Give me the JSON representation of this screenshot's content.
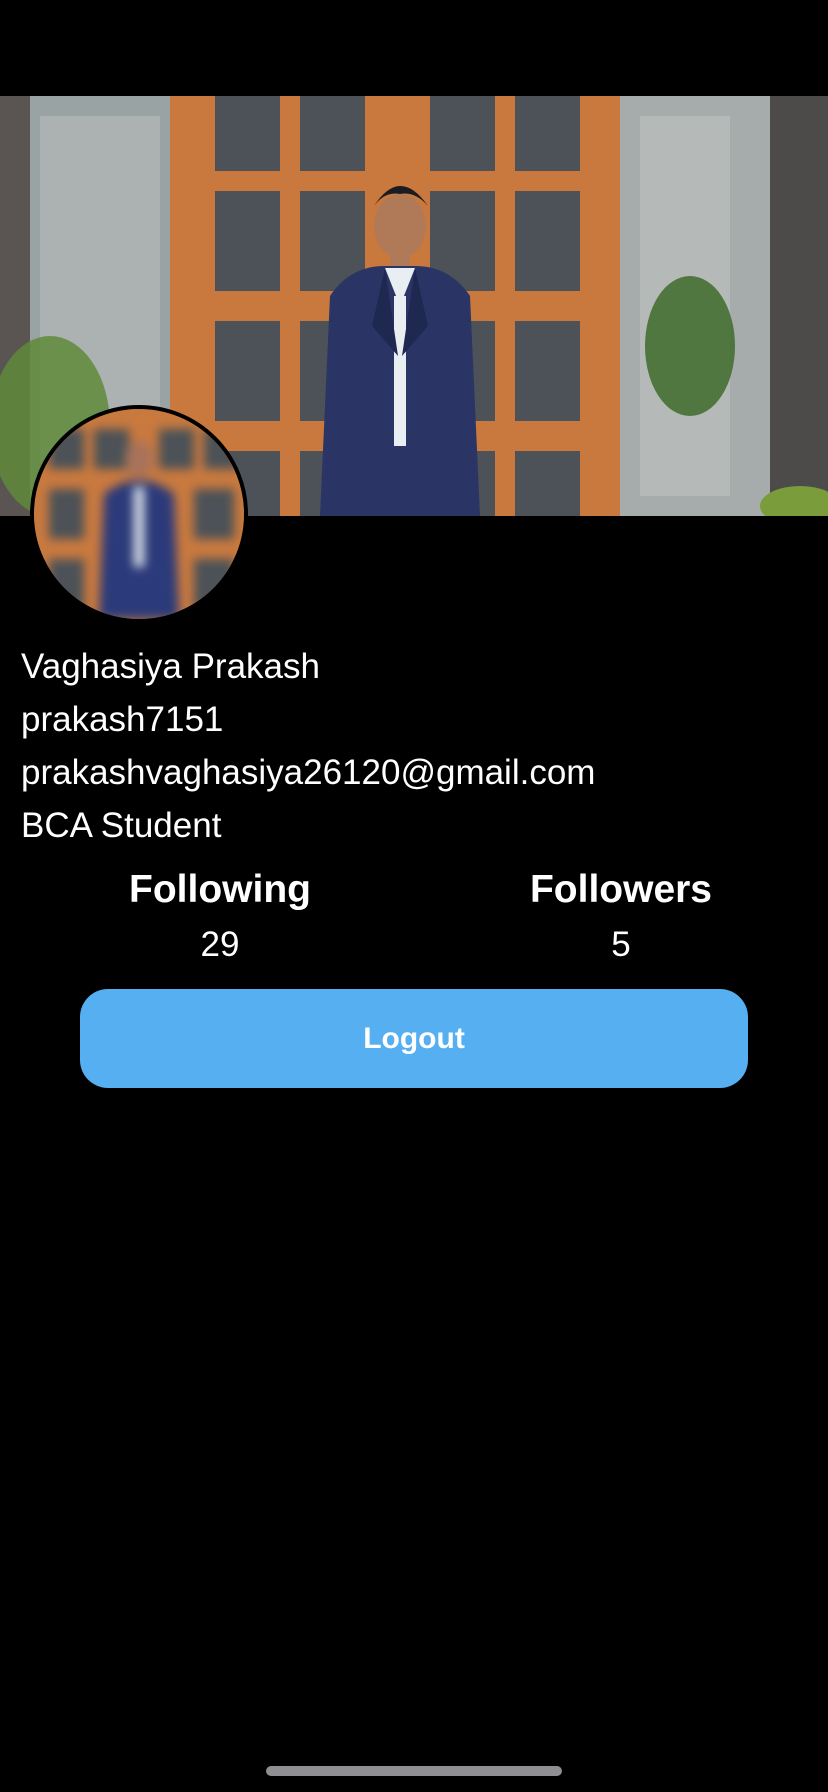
{
  "profile": {
    "name": "Vaghasiya Prakash",
    "username": "prakash7151",
    "email": "prakashvaghasiya26120@gmail.com",
    "bio": "BCA Student"
  },
  "stats": {
    "following_label": "Following",
    "following_count": "29",
    "followers_label": "Followers",
    "followers_count": "5"
  },
  "actions": {
    "logout_label": "Logout"
  },
  "colors": {
    "background": "#000000",
    "accent": "#55aff0",
    "text": "#ffffff"
  }
}
